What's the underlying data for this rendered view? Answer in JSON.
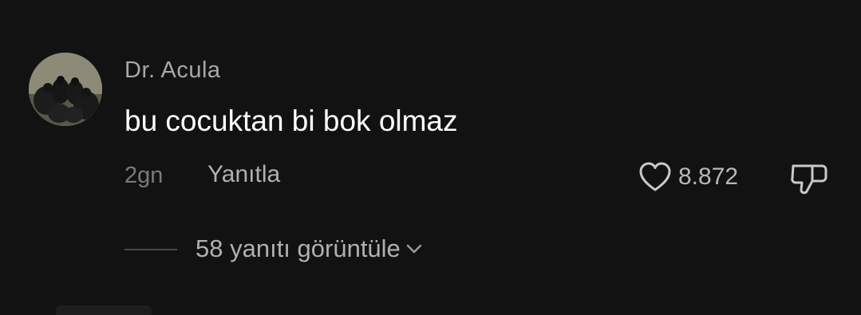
{
  "comment": {
    "username": "Dr. Acula",
    "text": "bu cocuktan bi bok olmaz",
    "timestamp": "2gn",
    "reply_label": "Yanıtla",
    "like_count": "8.872",
    "view_replies_label": "58 yanıtı görüntüle"
  },
  "icons": {
    "like": "heart-icon",
    "dislike": "thumbs-down-icon",
    "expand": "chevron-down-icon"
  },
  "colors": {
    "background": "#121212",
    "primary_text": "#ffffff",
    "secondary_text": "#a8a8a8",
    "muted_text": "#7a7a7a"
  }
}
